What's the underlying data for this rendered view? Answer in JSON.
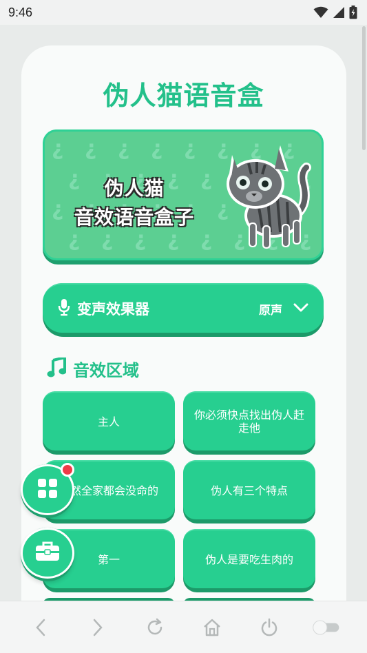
{
  "status_bar": {
    "time": "9:46"
  },
  "app": {
    "title": "伪人猫语音盒"
  },
  "banner": {
    "line1": "伪人猫",
    "line2": "音效语音盒子"
  },
  "voice_changer": {
    "label": "变声效果器",
    "value": "原声"
  },
  "section": {
    "title": "音效区域"
  },
  "sounds": [
    {
      "label": "主人"
    },
    {
      "label": "你必须快点找出伪人赶走他"
    },
    {
      "label": "不然全家都会没命的"
    },
    {
      "label": "伪人有三个特点"
    },
    {
      "label": "第一"
    },
    {
      "label": "伪人是要吃生肉的"
    }
  ],
  "colors": {
    "accent": "#27cf90",
    "accent_dark": "#1c9a69",
    "title": "#23c08a",
    "badge": "#ef3a47"
  },
  "icons": {
    "wifi": "wifi-icon",
    "signal": "signal-icon",
    "battery": "battery-charging-icon",
    "mic": "microphone-icon",
    "chevron": "chevron-down-icon",
    "music": "music-note-icon",
    "grid": "grid-icon",
    "toolbox": "toolbox-icon",
    "back": "back-icon",
    "forward": "forward-icon",
    "refresh": "refresh-icon",
    "home": "home-icon",
    "power": "power-icon",
    "toggle": "toggle-icon"
  }
}
